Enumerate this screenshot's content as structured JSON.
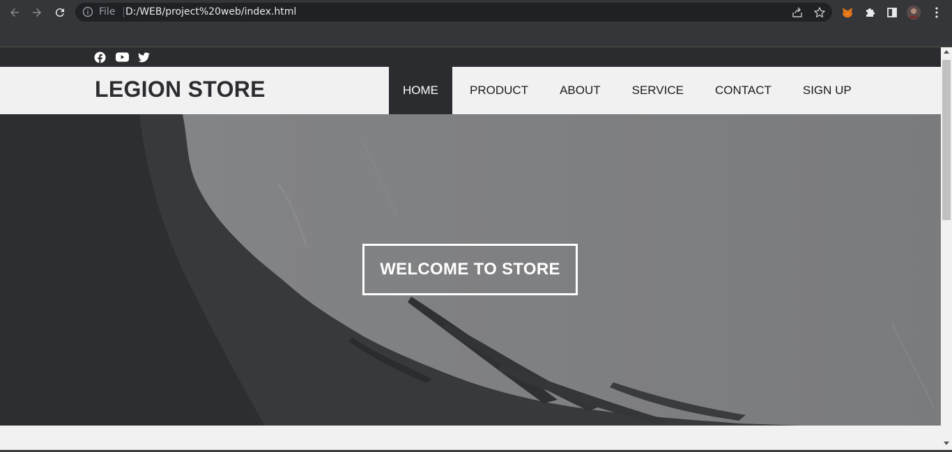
{
  "browser": {
    "file_label": "File",
    "url": "D:/WEB/project%20web/index.html",
    "icons": [
      "back-arrow-icon",
      "forward-arrow-icon",
      "reload-icon",
      "info-icon",
      "share-icon",
      "star-icon",
      "metamask-fox-icon",
      "puzzle-extension-icon",
      "side-panel-icon",
      "profile-avatar",
      "kebab-menu-icon"
    ]
  },
  "site": {
    "social": [
      "facebook-icon",
      "youtube-icon",
      "twitter-icon"
    ],
    "logo": "LEGION STORE",
    "nav": [
      {
        "label": "HOME",
        "active": true
      },
      {
        "label": "PRODUCT",
        "active": false
      },
      {
        "label": "ABOUT",
        "active": false
      },
      {
        "label": "SERVICE",
        "active": false
      },
      {
        "label": "CONTACT",
        "active": false
      },
      {
        "label": "SIGN UP",
        "active": false
      }
    ],
    "hero_title": "WELCOME TO STORE"
  },
  "colors": {
    "dark_bar": "#2b2c2f",
    "page_bg": "#f1f1f1",
    "hero_grey": "#7b7c7e",
    "chrome_bg": "#35363a"
  }
}
